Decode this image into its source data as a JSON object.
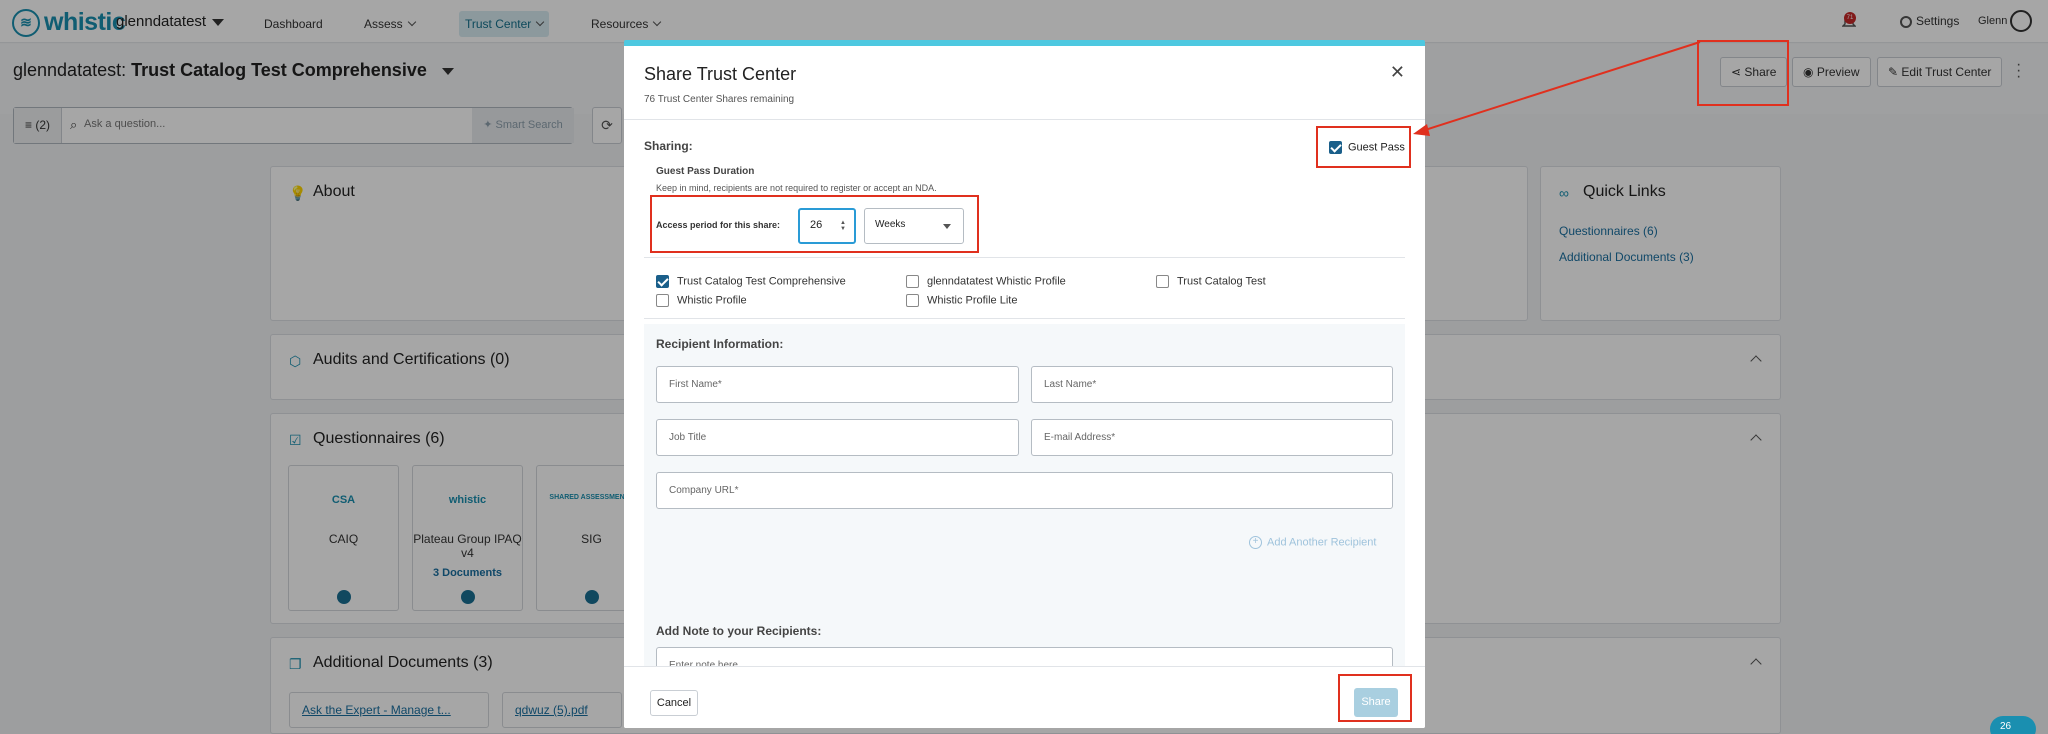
{
  "app": {
    "brand": "whistic",
    "account": "glenndatatest"
  },
  "nav": {
    "items": [
      {
        "label": "Dashboard"
      },
      {
        "label": "Assess"
      },
      {
        "label": "Trust Center"
      },
      {
        "label": "Resources"
      }
    ],
    "notifications_count": "71",
    "settings_label": "Settings",
    "user_name": "Glenn"
  },
  "header": {
    "account_prefix": "glenndatatest:",
    "title": "Trust Catalog Test Comprehensive",
    "share_label": "Share",
    "preview_label": "Preview",
    "edit_label": "Edit Trust Center"
  },
  "search": {
    "filter_label": "(2)",
    "placeholder": "Ask a question...",
    "smart_search_label": "Smart Search"
  },
  "cards": {
    "about_title": "About",
    "audits_title": "Audits and Certifications (0)",
    "questionnaires_title": "Questionnaires (6)",
    "additional_docs_title": "Additional Documents (3)",
    "quick_links_title": "Quick Links",
    "quick_links": [
      {
        "label": "Questionnaires (6)"
      },
      {
        "label": "Additional Documents (3)"
      }
    ],
    "questionnaires": [
      {
        "logo": "CSA",
        "name": "CAIQ",
        "docs": ""
      },
      {
        "logo": "whistic",
        "name": "Plateau Group IPAQ v4",
        "docs": "3 Documents"
      },
      {
        "logo": "SHARED ASSESSMENTS",
        "name": "SIG",
        "docs": ""
      }
    ],
    "documents": [
      {
        "label": "Ask the Expert - Manage t..."
      },
      {
        "label": "qdwuz (5).pdf"
      }
    ]
  },
  "modal": {
    "title": "Share Trust Center",
    "subtitle": "76 Trust Center Shares remaining",
    "sharing_label": "Sharing:",
    "guest_pass_label": "Guest Pass",
    "guest_pass_checked": true,
    "guest_pass_duration_title": "Guest Pass Duration",
    "guest_pass_note": "Keep in mind, recipients are not required to register or accept an NDA.",
    "access_period_label": "Access period for this share:",
    "access_period_value": "26",
    "access_period_unit": "Weeks",
    "doc_options": [
      {
        "label": "Trust Catalog Test Comprehensive",
        "checked": true
      },
      {
        "label": "glenndatatest Whistic Profile",
        "checked": false
      },
      {
        "label": "Trust Catalog Test",
        "checked": false
      },
      {
        "label": "Whistic Profile",
        "checked": false
      },
      {
        "label": "Whistic Profile Lite",
        "checked": false
      }
    ],
    "recipient_title": "Recipient Information:",
    "fields": {
      "first_name": "First Name*",
      "last_name": "Last Name*",
      "job_title": "Job Title",
      "email": "E-mail Address*",
      "company_url": "Company URL*"
    },
    "add_recipient_label": "Add Another Recipient",
    "note_title": "Add Note to your Recipients:",
    "note_placeholder": "Enter note here",
    "cancel_label": "Cancel",
    "share_label": "Share"
  },
  "chat_badge": "26",
  "colors": {
    "brand": "#1a8fb0",
    "modal_accent": "#4dc8e0",
    "annotation": "#e0301e",
    "checkbox": "#1a5f8a"
  }
}
